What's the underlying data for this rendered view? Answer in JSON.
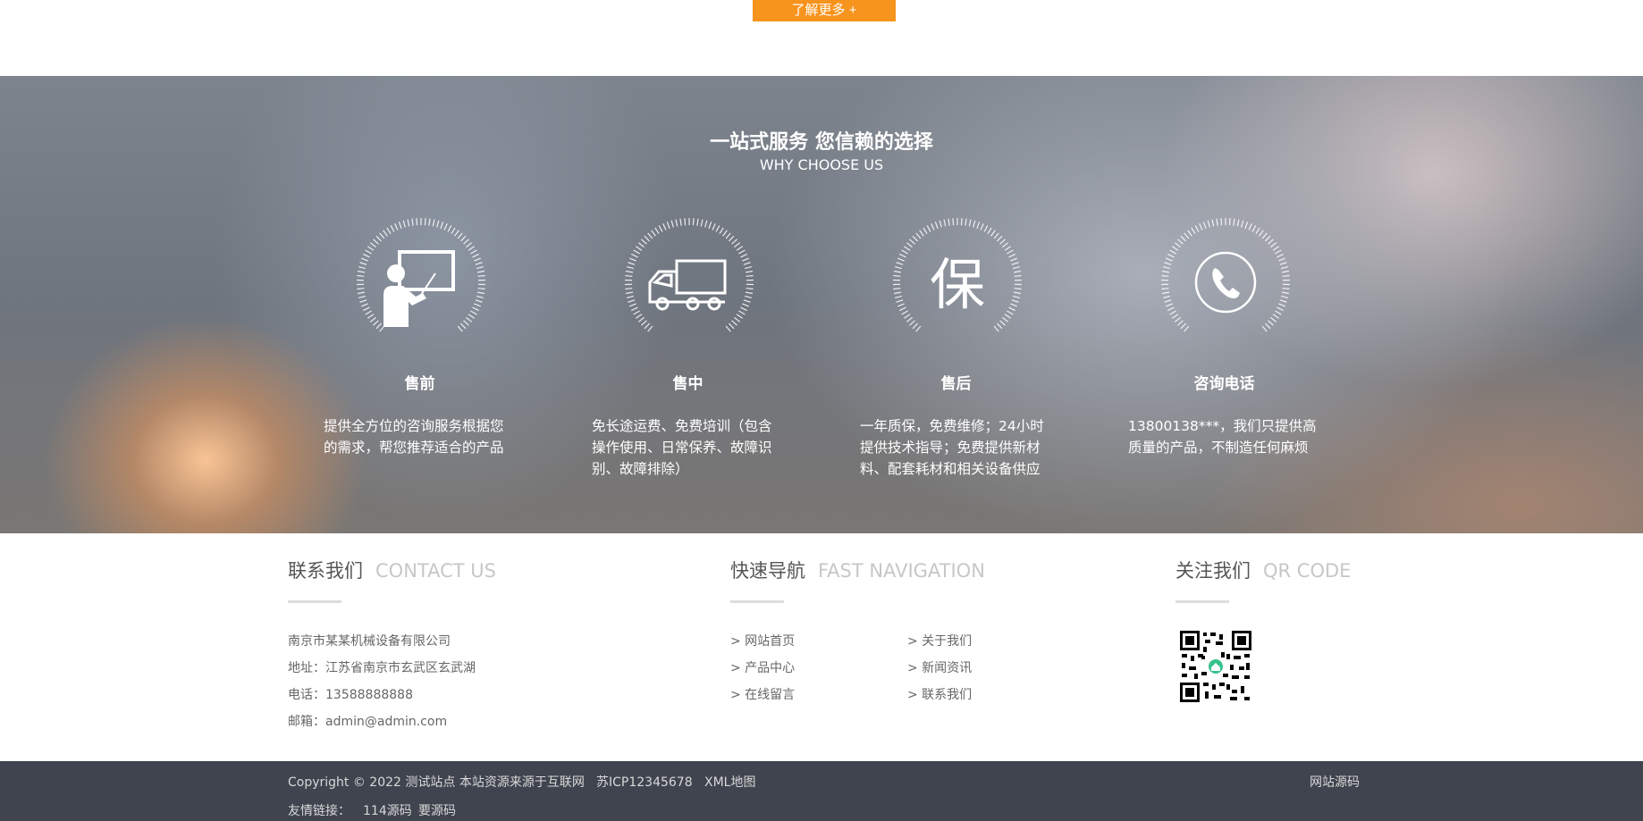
{
  "top": {
    "more_button": "了解更多 +"
  },
  "why": {
    "title": "一站式服务 您信赖的选择",
    "subtitle": "WHY CHOOSE US",
    "features": [
      {
        "icon": "presentation-icon",
        "title": "售前",
        "desc": "提供全方位的咨询服务根据您的需求，帮您推荐适合的产品"
      },
      {
        "icon": "truck-icon",
        "title": "售中",
        "desc": "免长途运费、免费培训（包含操作使用、日常保养、故障识别、故障排除）"
      },
      {
        "icon": "warranty-icon",
        "title": "售后",
        "desc": "一年质保，免费维修；24小时提供技术指导；免费提供新材料、配套耗材和相关设备供应"
      },
      {
        "icon": "phone-icon",
        "title": "咨询电话",
        "desc": "13800138***，我们只提供高质量的产品，不制造任何麻烦"
      }
    ],
    "warranty_glyph": "保"
  },
  "contact": {
    "title_cn": "联系我们",
    "title_en": "CONTACT US",
    "company": "南京市某某机械设备有限公司",
    "address": "地址：江苏省南京市玄武区玄武湖",
    "phone": "电话：13588888888",
    "email": "邮箱：admin@admin.com"
  },
  "nav": {
    "title_cn": "快速导航",
    "title_en": "FAST NAVIGATION",
    "links": [
      "> 网站首页",
      "> 关于我们",
      "> 产品中心",
      "> 新闻资讯",
      "> 在线留言",
      "> 联系我们"
    ]
  },
  "qr": {
    "title_cn": "关注我们",
    "title_en": "QR CODE"
  },
  "bottom": {
    "copyright": "Copyright © 2022 测试站点 本站资源来源于互联网",
    "icp": "苏ICP12345678",
    "sitemap": "XML地图",
    "source": "网站源码",
    "friend_label": "友情链接：",
    "friend_links": [
      "114源码",
      "要源码"
    ]
  },
  "colors": {
    "accent": "#f7941d",
    "footer_bg": "#3f444f",
    "underline": "#dddddd"
  }
}
